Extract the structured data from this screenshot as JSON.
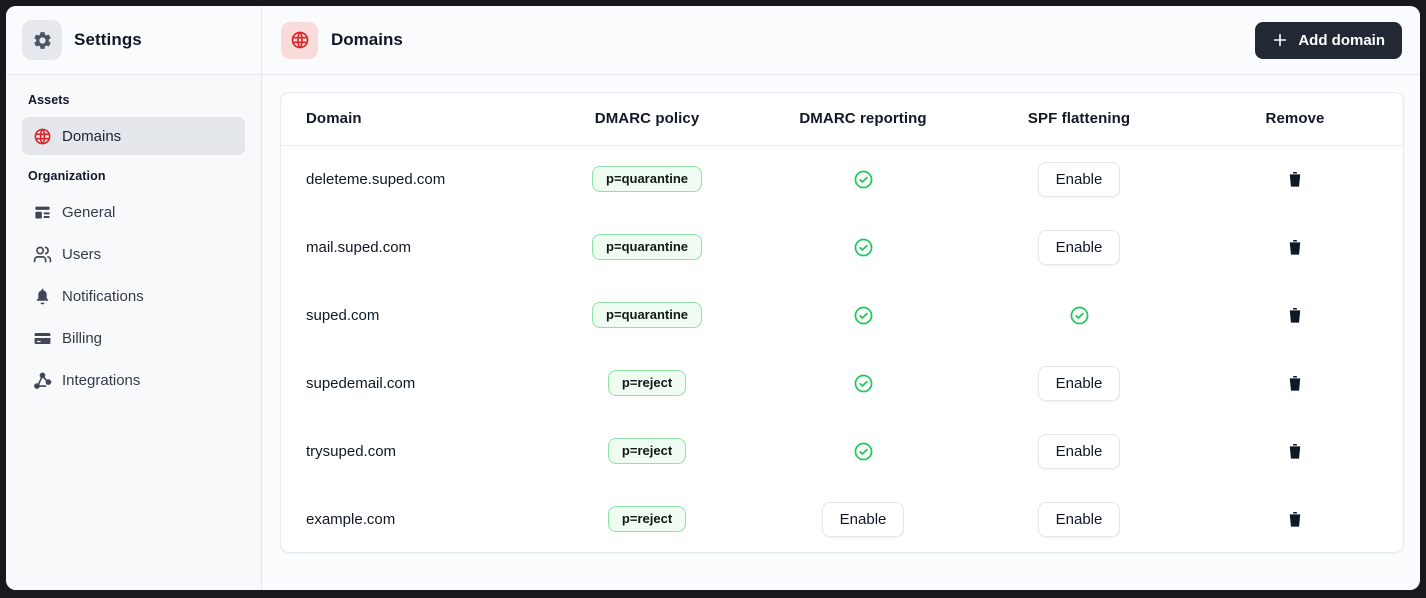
{
  "colors": {
    "accent_red": "#dc2626",
    "success_green": "#22c55e",
    "badge_bg": "#f0fbf2",
    "badge_border": "#8ee3a5",
    "dark_button_bg": "#222935",
    "active_item_bg": "#e3e7eb",
    "frame": "#17191d"
  },
  "sidebar": {
    "title": "Settings",
    "title_icon": "gear-icon",
    "sections": [
      {
        "label": "Assets",
        "items": [
          {
            "label": "Domains",
            "icon": "globe-icon",
            "active": true
          }
        ]
      },
      {
        "label": "Organization",
        "items": [
          {
            "label": "General",
            "icon": "panel-icon"
          },
          {
            "label": "Users",
            "icon": "users-icon"
          },
          {
            "label": "Notifications",
            "icon": "bell-icon"
          },
          {
            "label": "Billing",
            "icon": "credit-card-icon"
          },
          {
            "label": "Integrations",
            "icon": "integrations-icon"
          }
        ]
      }
    ]
  },
  "header": {
    "title": "Domains",
    "icon": "globe-icon",
    "add_button_label": "Add domain"
  },
  "table": {
    "columns": [
      "Domain",
      "DMARC policy",
      "DMARC reporting",
      "SPF flattening",
      "Remove"
    ],
    "enable_label": "Enable",
    "rows": [
      {
        "domain": "deleteme.suped.com",
        "dmarc_policy": "p=quarantine",
        "dmarc_reporting": "enabled",
        "spf_flattening": "disabled"
      },
      {
        "domain": "mail.suped.com",
        "dmarc_policy": "p=quarantine",
        "dmarc_reporting": "enabled",
        "spf_flattening": "disabled"
      },
      {
        "domain": "suped.com",
        "dmarc_policy": "p=quarantine",
        "dmarc_reporting": "enabled",
        "spf_flattening": "enabled"
      },
      {
        "domain": "supedemail.com",
        "dmarc_policy": "p=reject",
        "dmarc_reporting": "enabled",
        "spf_flattening": "disabled"
      },
      {
        "domain": "trysuped.com",
        "dmarc_policy": "p=reject",
        "dmarc_reporting": "enabled",
        "spf_flattening": "disabled"
      },
      {
        "domain": "example.com",
        "dmarc_policy": "p=reject",
        "dmarc_reporting": "disabled",
        "spf_flattening": "disabled"
      }
    ]
  }
}
